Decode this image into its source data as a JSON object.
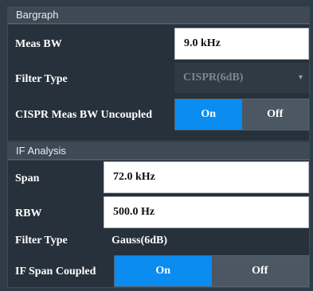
{
  "bargraph": {
    "header": "Bargraph",
    "meas_bw": {
      "label": "Meas BW",
      "value": "9.0 kHz"
    },
    "filter_type": {
      "label": "Filter Type",
      "value": "CISPR(6dB)"
    },
    "cispr_uncoupled": {
      "label": "CISPR Meas BW Uncoupled",
      "on": "On",
      "off": "Off",
      "selected": "On"
    }
  },
  "if_analysis": {
    "header": "IF Analysis",
    "span": {
      "label": "Span",
      "value": "72.0 kHz"
    },
    "rbw": {
      "label": "RBW",
      "value": "500.0 Hz"
    },
    "filter_type": {
      "label": "Filter Type",
      "value": "Gauss(6dB)"
    },
    "if_span_coupled": {
      "label": "IF Span Coupled",
      "on": "On",
      "off": "Off",
      "selected": "On"
    }
  },
  "colors": {
    "accent": "#0a8cf0",
    "panel": "#26313b",
    "header": "#3d4a56"
  },
  "icons": {
    "dropdown": "chevron-down-icon"
  }
}
